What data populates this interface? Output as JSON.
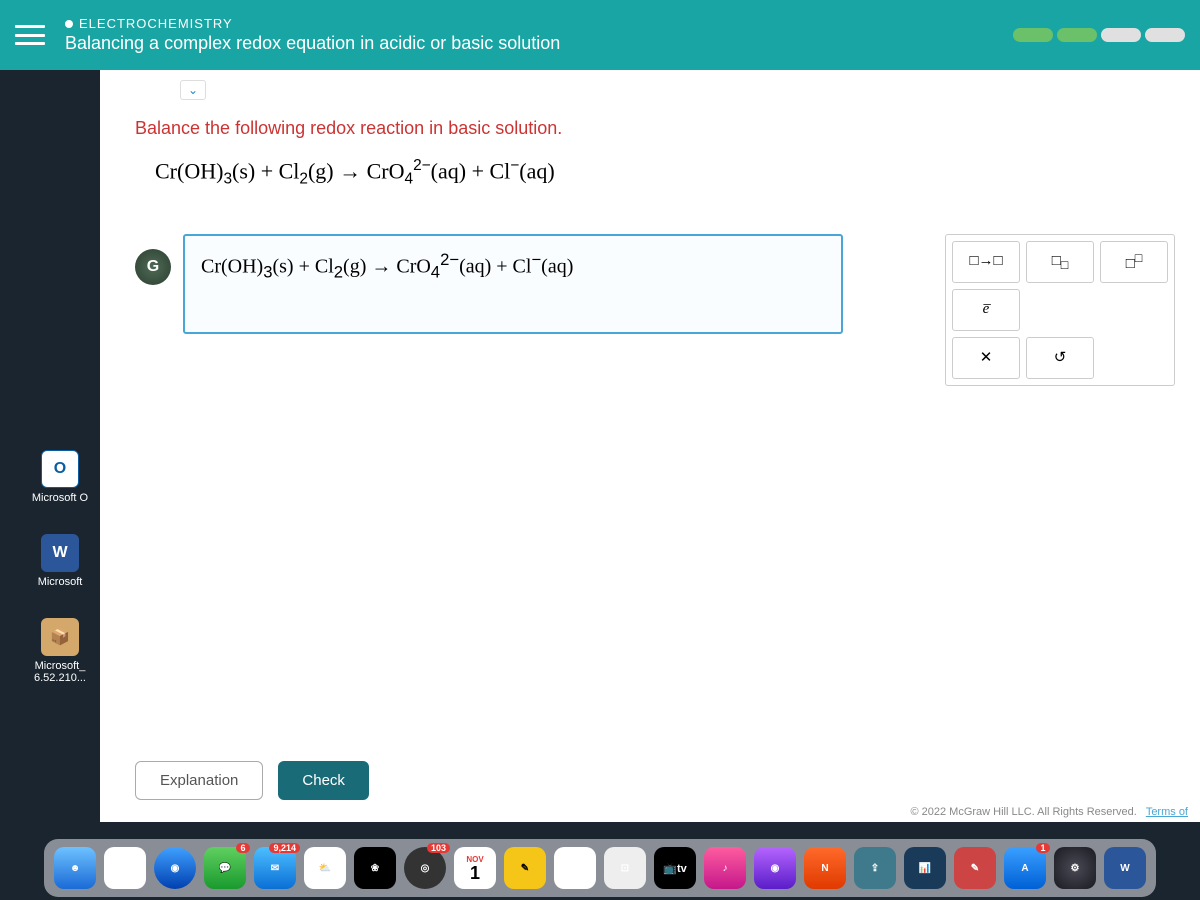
{
  "header": {
    "category": "ELECTROCHEMISTRY",
    "title": "Balancing a complex redox equation in acidic or basic solution"
  },
  "problem": {
    "prompt": "Balance the following redox reaction in basic solution.",
    "equation_html": "Cr(OH)<sub>3</sub>(s) + Cl<sub>2</sub>(g) → CrO<sub>4</sub><sup>2−</sup>(aq) + Cl<sup>−</sup>(aq)"
  },
  "answer": {
    "g_label": "G",
    "input_html": "Cr(OH)<sub>3</sub>(s) + Cl<sub>2</sub>(g) → CrO<sub>4</sub><sup>2−</sup>(aq) + Cl<sup>−</sup>(aq)"
  },
  "palette": {
    "arrow": "□→□",
    "subscript": "□□",
    "superscript": "□□",
    "electron": "e̅",
    "blank1": "",
    "blank2": "",
    "clear": "✕",
    "undo": "↺"
  },
  "actions": {
    "explanation": "Explanation",
    "check": "Check"
  },
  "footer": {
    "copyright": "© 2022 McGraw Hill LLC. All Rights Reserved.",
    "terms": "Terms of"
  },
  "desktop": {
    "outlook": {
      "icon": "O",
      "label": "Microsoft O"
    },
    "word": {
      "icon": "W",
      "label": "Microsoft"
    },
    "package": {
      "icon": "📦",
      "label_1": "Microsoft_",
      "label_2": "6.52.210..."
    }
  },
  "dock": {
    "mail_badge": "9,214",
    "mail_badge2": "6",
    "safari_badge": "103",
    "cal_month": "NOV",
    "cal_day": "1",
    "tv_label": "tv",
    "app_badge": "1"
  }
}
